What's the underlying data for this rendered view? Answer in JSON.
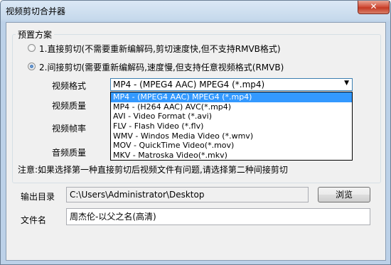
{
  "window": {
    "title": "视频剪切合并器",
    "close_label": "✕"
  },
  "preset": {
    "group_label": "预置方案",
    "options": [
      {
        "label": "1.直接剪切(不需要重新编解码,剪切速度快,但不支持RMVB格式)",
        "checked": false
      },
      {
        "label": "2.间接剪切(需要重新编解码,速度慢,但支持任意视频格式(RMVB)",
        "checked": true
      }
    ],
    "video_format_label": "视频格式",
    "video_quality_label": "视频质量",
    "video_framerate_label": "视频帧率",
    "audio_quality_label": "音频质量",
    "format_selected": "MP4 - (MPEG4 AAC) MPEG4 (*.mp4)",
    "format_options": [
      "MP4 - (MPEG4 AAC) MPEG4 (*.mp4)",
      "MP4 - (H264 AAC) AVC(*.mp4)",
      "AVI - Video Format (*.avi)",
      "FLV - Flash Video (*.flv)",
      "WMV - Windos Media Video (*.wmv)",
      "MOV - QuickTime Video(*.mov)",
      "MKV - Matroska Video(*.mkv)"
    ]
  },
  "note": "注意:如果选择第一种直接剪切后视频文件有问题,请选择第二种间接剪切",
  "output": {
    "dir_label": "输出目录",
    "dir_value": "C:\\Users\\Administrator\\Desktop",
    "browse_label": "浏览",
    "filename_label": "文件名",
    "filename_value": "周杰伦-以父之名(高清)"
  },
  "colors": {
    "selection": "#3399ff",
    "client_bg": "#f0f0f0",
    "title_bg": "#c6d9ec",
    "close_red": "#c43a24"
  }
}
